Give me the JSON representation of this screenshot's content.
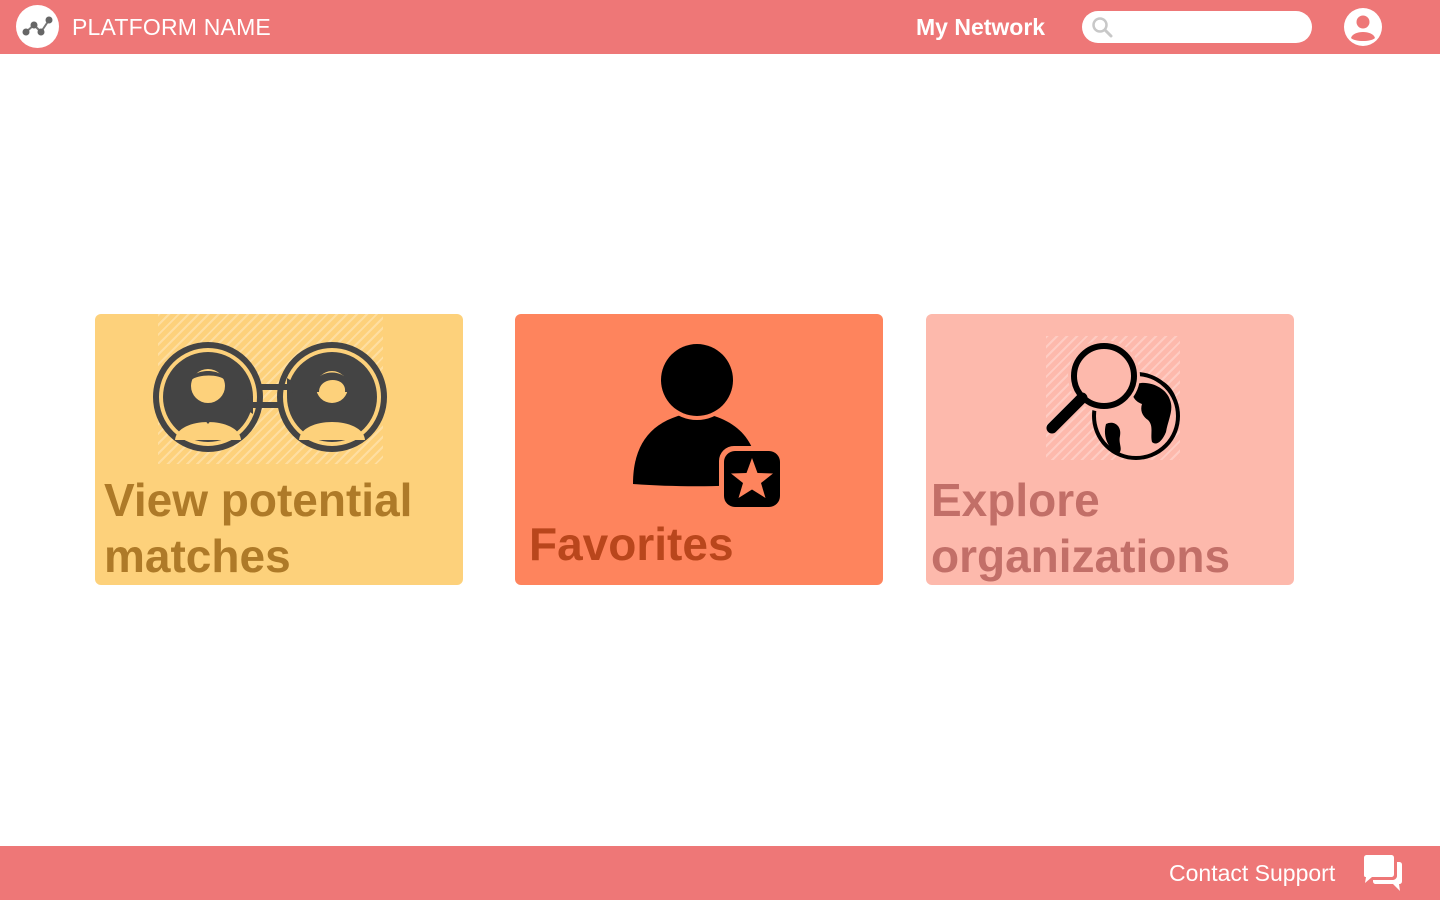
{
  "header": {
    "platform_name": "PLATFORM NAME",
    "nav_my_network": "My Network",
    "search_placeholder": "",
    "logo_icon": "network-graph-icon",
    "search_icon": "magnifier-icon",
    "avatar_icon": "user-circle-icon"
  },
  "cards": [
    {
      "label": "View potential matches",
      "icon": "people-exchange-icon",
      "color": "#fdd17b",
      "text_color": "#ae7a28"
    },
    {
      "label": "Favorites",
      "icon": "person-star-icon",
      "color": "#fe845d",
      "text_color": "#b9461c"
    },
    {
      "label": "Explore organizations",
      "icon": "magnifier-globe-icon",
      "color": "#fdb9ac",
      "text_color": "#c26f68"
    }
  ],
  "footer": {
    "contact_support": "Contact Support",
    "chat_icon": "chat-bubbles-icon"
  },
  "theme": {
    "bar_color": "#ee7777",
    "background": "#ffffff"
  }
}
